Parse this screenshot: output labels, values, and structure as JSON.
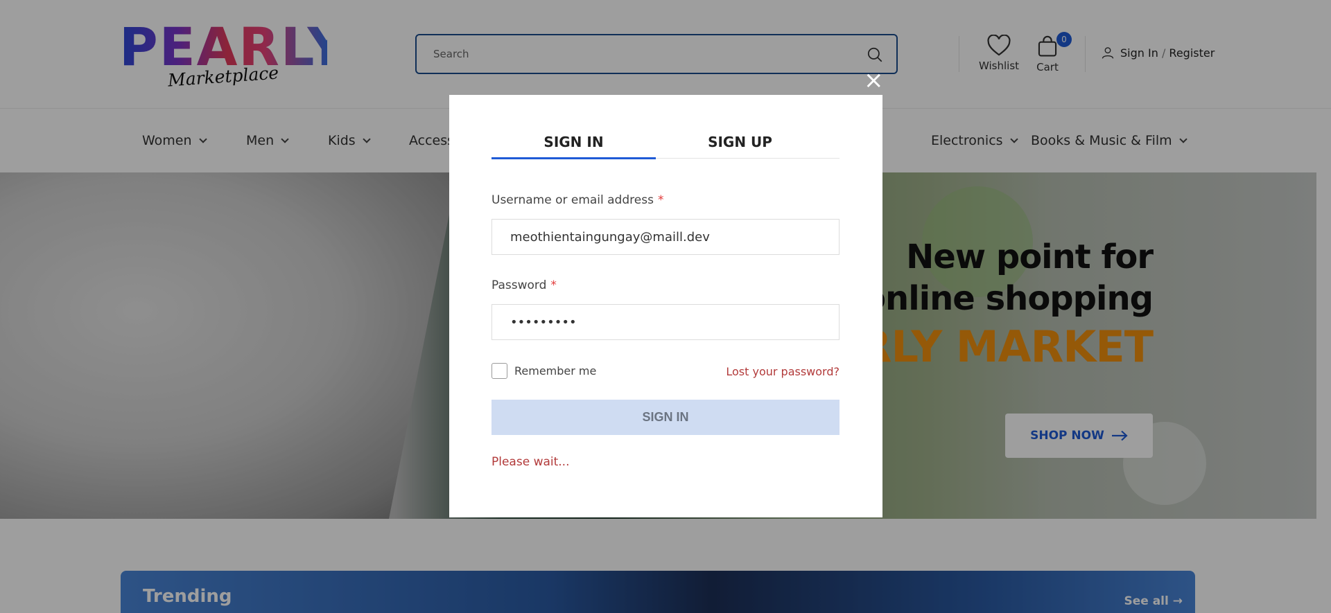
{
  "header": {
    "logo_text": "PEARLY",
    "logo_sub": "Marketplace",
    "search_placeholder": "Search",
    "wishlist_label": "Wishlist",
    "cart_label": "Cart",
    "cart_count": "0",
    "signin_label": "Sign In",
    "register_label": "Register",
    "slash": "/"
  },
  "nav": {
    "items": [
      {
        "label": "Women"
      },
      {
        "label": "Men"
      },
      {
        "label": "Kids"
      },
      {
        "label": "Access"
      },
      {
        "label": "Electronics"
      },
      {
        "label": "Books & Music & Film"
      }
    ]
  },
  "hero": {
    "line1": "New point for",
    "line2": "online shopping",
    "line3": "ARLY MARKET",
    "cta_label": "SHOP NOW"
  },
  "trending": {
    "title": "Trending",
    "see_all": "See all →"
  },
  "modal": {
    "close_glyph": "×",
    "tab_signin": "SIGN IN",
    "tab_signup": "SIGN UP",
    "username_label": "Username or email address",
    "username_value": "meothientaingungay@maill.dev",
    "password_label": "Password",
    "password_value": "•••••••••",
    "required_mark": "*",
    "remember_label": "Remember me",
    "lost_password": "Lost your password?",
    "signin_button": "SIGN IN",
    "status_text": "Please wait..."
  },
  "colors": {
    "accent": "#1f5bd6",
    "hero_orange": "#f0900e",
    "error_red": "#b23a3a"
  }
}
